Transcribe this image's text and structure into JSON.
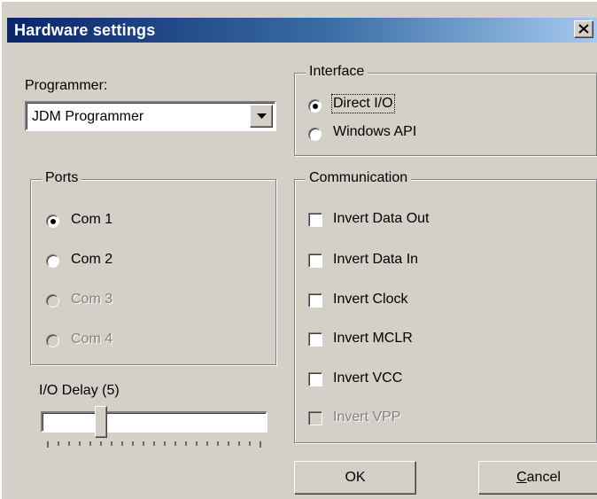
{
  "window": {
    "title": "Hardware settings",
    "close_icon": "close-icon"
  },
  "programmer": {
    "label": "Programmer:",
    "value": "JDM Programmer"
  },
  "interface": {
    "title": "Interface",
    "options": [
      {
        "label": "Direct I/O",
        "checked": true
      },
      {
        "label": "Windows API",
        "checked": false
      }
    ]
  },
  "ports": {
    "title": "Ports",
    "options": [
      {
        "label": "Com 1",
        "checked": true,
        "enabled": true
      },
      {
        "label": "Com 2",
        "checked": false,
        "enabled": true
      },
      {
        "label": "Com 3",
        "checked": false,
        "enabled": false
      },
      {
        "label": "Com 4",
        "checked": false,
        "enabled": false
      }
    ]
  },
  "communication": {
    "title": "Communication",
    "options": [
      {
        "label": "Invert Data Out",
        "checked": false,
        "enabled": true
      },
      {
        "label": "Invert Data In",
        "checked": false,
        "enabled": true
      },
      {
        "label": "Invert Clock",
        "checked": false,
        "enabled": true
      },
      {
        "label": "Invert MCLR",
        "checked": false,
        "enabled": true
      },
      {
        "label": "Invert VCC",
        "checked": false,
        "enabled": true
      },
      {
        "label": "Invert VPP",
        "checked": false,
        "enabled": false
      }
    ]
  },
  "io_delay": {
    "label": "I/O Delay (5)",
    "value": 5,
    "min": 0,
    "max": 20
  },
  "buttons": {
    "ok": "OK",
    "cancel_prefix": "C",
    "cancel_rest": "ancel"
  },
  "colors": {
    "titlebar_start": "#0a246a",
    "titlebar_end": "#a6caf0",
    "face": "#d4d0c8"
  }
}
